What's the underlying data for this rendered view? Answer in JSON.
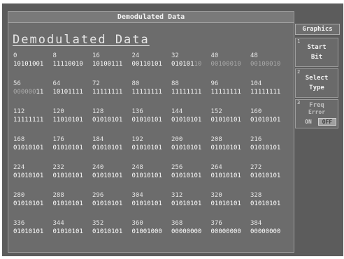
{
  "window": {
    "title": "Demodulated Data"
  },
  "heading": "Demodulated Data",
  "softkeys": {
    "menu_title": "Graphics",
    "start_bit": {
      "num": "1",
      "line1": "Start",
      "line2": "Bit"
    },
    "select_type": {
      "num": "2",
      "line1": "Select",
      "line2": "Type"
    },
    "freq_error": {
      "num": "3",
      "line1": "Freq",
      "line2": "Error",
      "on": "ON",
      "off": "OFF",
      "selected": "OFF"
    }
  },
  "rows": [
    {
      "cells": [
        {
          "addr": "0",
          "bright": "10101001",
          "dim": ""
        },
        {
          "addr": "8",
          "bright": "11110010",
          "dim": ""
        },
        {
          "addr": "16",
          "bright": "10100111",
          "dim": ""
        },
        {
          "addr": "24",
          "bright": "00110101",
          "dim": ""
        },
        {
          "addr": "32",
          "bright": "010101",
          "dim": "10"
        },
        {
          "addr": "40",
          "bright": "",
          "dim": "00100010"
        },
        {
          "addr": "48",
          "bright": "",
          "dim": "00100010"
        }
      ]
    },
    {
      "cells": [
        {
          "addr": "56",
          "bright": "11",
          "dim": "000000",
          "dim_first": true
        },
        {
          "addr": "64",
          "bright": "10101111",
          "dim": ""
        },
        {
          "addr": "72",
          "bright": "11111111",
          "dim": ""
        },
        {
          "addr": "80",
          "bright": "11111111",
          "dim": ""
        },
        {
          "addr": "88",
          "bright": "11111111",
          "dim": ""
        },
        {
          "addr": "96",
          "bright": "11111111",
          "dim": ""
        },
        {
          "addr": "104",
          "bright": "11111111",
          "dim": ""
        }
      ]
    },
    {
      "cells": [
        {
          "addr": "112",
          "bright": "11111111",
          "dim": ""
        },
        {
          "addr": "120",
          "bright": "11010101",
          "dim": ""
        },
        {
          "addr": "128",
          "bright": "01010101",
          "dim": ""
        },
        {
          "addr": "136",
          "bright": "01010101",
          "dim": ""
        },
        {
          "addr": "144",
          "bright": "01010101",
          "dim": ""
        },
        {
          "addr": "152",
          "bright": "01010101",
          "dim": ""
        },
        {
          "addr": "160",
          "bright": "01010101",
          "dim": ""
        }
      ]
    },
    {
      "cells": [
        {
          "addr": "168",
          "bright": "01010101",
          "dim": ""
        },
        {
          "addr": "176",
          "bright": "01010101",
          "dim": ""
        },
        {
          "addr": "184",
          "bright": "01010101",
          "dim": ""
        },
        {
          "addr": "192",
          "bright": "01010101",
          "dim": ""
        },
        {
          "addr": "200",
          "bright": "01010101",
          "dim": ""
        },
        {
          "addr": "208",
          "bright": "01010101",
          "dim": ""
        },
        {
          "addr": "216",
          "bright": "01010101",
          "dim": ""
        }
      ]
    },
    {
      "cells": [
        {
          "addr": "224",
          "bright": "01010101",
          "dim": ""
        },
        {
          "addr": "232",
          "bright": "01010101",
          "dim": ""
        },
        {
          "addr": "240",
          "bright": "01010101",
          "dim": ""
        },
        {
          "addr": "248",
          "bright": "01010101",
          "dim": ""
        },
        {
          "addr": "256",
          "bright": "01010101",
          "dim": ""
        },
        {
          "addr": "264",
          "bright": "01010101",
          "dim": ""
        },
        {
          "addr": "272",
          "bright": "01010101",
          "dim": ""
        }
      ]
    },
    {
      "cells": [
        {
          "addr": "280",
          "bright": "01010101",
          "dim": ""
        },
        {
          "addr": "288",
          "bright": "01010101",
          "dim": ""
        },
        {
          "addr": "296",
          "bright": "01010101",
          "dim": ""
        },
        {
          "addr": "304",
          "bright": "01010101",
          "dim": ""
        },
        {
          "addr": "312",
          "bright": "01010101",
          "dim": ""
        },
        {
          "addr": "320",
          "bright": "01010101",
          "dim": ""
        },
        {
          "addr": "328",
          "bright": "01010101",
          "dim": ""
        }
      ]
    },
    {
      "cells": [
        {
          "addr": "336",
          "bright": "01010101",
          "dim": ""
        },
        {
          "addr": "344",
          "bright": "01010101",
          "dim": ""
        },
        {
          "addr": "352",
          "bright": "01010101",
          "dim": ""
        },
        {
          "addr": "360",
          "bright": "01001000",
          "dim": ""
        },
        {
          "addr": "368",
          "bright": "00000000",
          "dim": ""
        },
        {
          "addr": "376",
          "bright": "00000000",
          "dim": ""
        },
        {
          "addr": "384",
          "bright": "00000000",
          "dim": ""
        }
      ]
    }
  ],
  "colors": {
    "screen_bg": "#5c5c5c",
    "panel_bg": "#6c6c6c",
    "bright_text": "#ffffff",
    "dim_text": "#aaaaaa"
  }
}
